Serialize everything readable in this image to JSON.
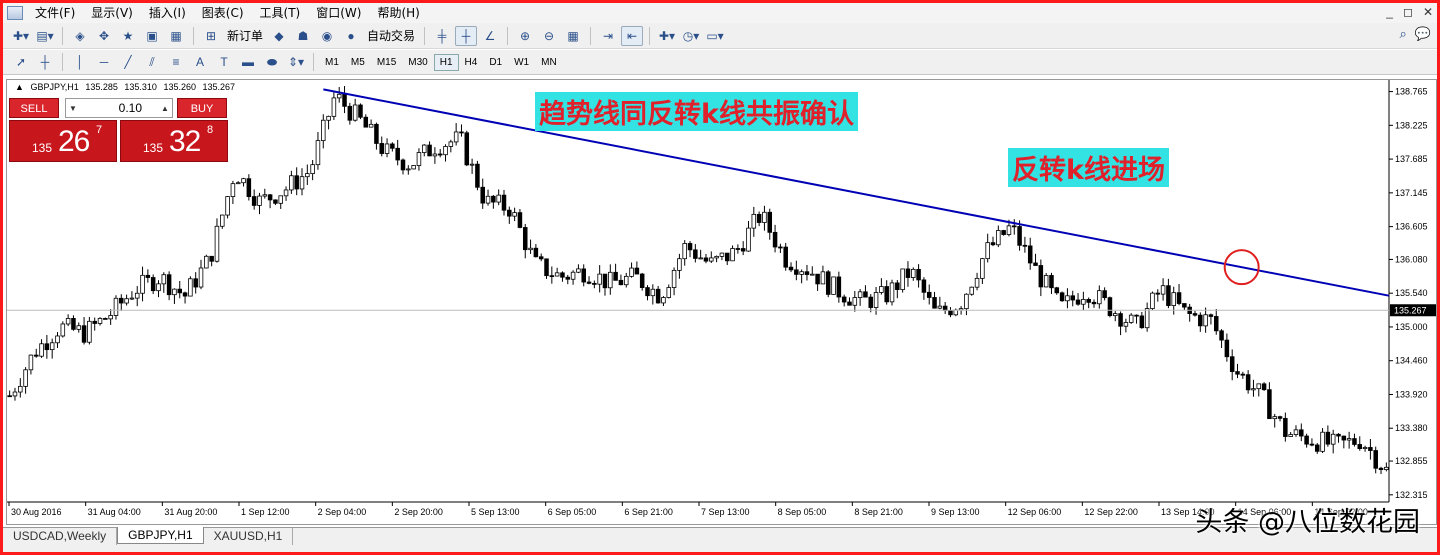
{
  "menu": {
    "items": [
      "文件(F)",
      "显示(V)",
      "插入(I)",
      "图表(C)",
      "工具(T)",
      "窗口(W)",
      "帮助(H)"
    ],
    "window_controls": [
      "_",
      "◻",
      "✕"
    ]
  },
  "toolbar": {
    "new_order_label": "新订单",
    "auto_trading_label": "自动交易"
  },
  "timeframes": {
    "items": [
      "M1",
      "M5",
      "M15",
      "M30",
      "H1",
      "H4",
      "D1",
      "W1",
      "MN"
    ],
    "active": "H1"
  },
  "drawing_tools": {
    "text_tool": "A",
    "label_tool": "T"
  },
  "symbol_info": {
    "symbol": "GBPJPY,H1",
    "open": "135.285",
    "high": "135.310",
    "low": "135.260",
    "close": "135.267"
  },
  "trade_panel": {
    "sell_label": "SELL",
    "buy_label": "BUY",
    "lot_value": "0.10",
    "sell_prefix": "135",
    "sell_big": "26",
    "sell_sup": "7",
    "buy_prefix": "135",
    "buy_big": "32",
    "buy_sup": "8",
    "accent": "#c8161d"
  },
  "annotations": {
    "trendline_note": "趋势线同反转k线共振确认",
    "entry_note": "反转k线进场",
    "annotation_bg": "#33e3e3",
    "annotation_text": "#e0202a"
  },
  "chart_data": {
    "type": "candlestick",
    "symbol": "GBPJPY",
    "timeframe": "H1",
    "current_price": 135.267,
    "ylim": [
      132.2,
      138.95
    ],
    "y_ticks": [
      "138.765",
      "138.225",
      "137.685",
      "137.145",
      "136.605",
      "136.080",
      "135.540",
      "135.000",
      "134.460",
      "133.920",
      "133.380",
      "132.855",
      "132.315"
    ],
    "x_ticks": [
      "30 Aug 2016",
      "31 Aug 04:00",
      "31 Aug 20:00",
      "1 Sep 12:00",
      "2 Sep 04:00",
      "2 Sep 20:00",
      "5 Sep 13:00",
      "6 Sep 05:00",
      "6 Sep 21:00",
      "7 Sep 13:00",
      "8 Sep 05:00",
      "8 Sep 21:00",
      "9 Sep 13:00",
      "12 Sep 06:00",
      "12 Sep 22:00",
      "13 Sep 14:00",
      "14 Sep 06:00",
      "14 Sep 22:00"
    ],
    "price_path_closes": [
      133.9,
      134.6,
      135.0,
      134.9,
      135.2,
      135.6,
      135.8,
      135.5,
      136.1,
      137.5,
      137.0,
      137.2,
      137.5,
      138.7,
      138.3,
      137.8,
      137.6,
      137.9,
      138.0,
      137.0,
      136.9,
      136.0,
      135.8,
      135.9,
      135.7,
      135.8,
      135.5,
      136.3,
      136.0,
      136.2,
      136.8,
      136.1,
      135.9,
      135.6,
      135.4,
      135.5,
      135.9,
      135.2,
      135.4,
      136.2,
      136.6,
      135.9,
      135.3,
      135.6,
      135.3,
      135.0,
      135.6,
      135.2,
      135.1,
      134.3,
      133.9,
      133.3,
      133.2,
      133.1,
      133.2,
      132.7
    ],
    "trendline": {
      "from": {
        "x": "2 Sep 04:00",
        "y": 138.8
      },
      "to": {
        "x": "14 Sep 22:00",
        "y": 135.5
      }
    },
    "grid": false
  },
  "tabs": {
    "items": [
      "USDCAD,Weekly",
      "GBPJPY,H1",
      "XAUUSD,H1"
    ],
    "active": "GBPJPY,H1"
  },
  "watermark": "头条 @八位数花园"
}
